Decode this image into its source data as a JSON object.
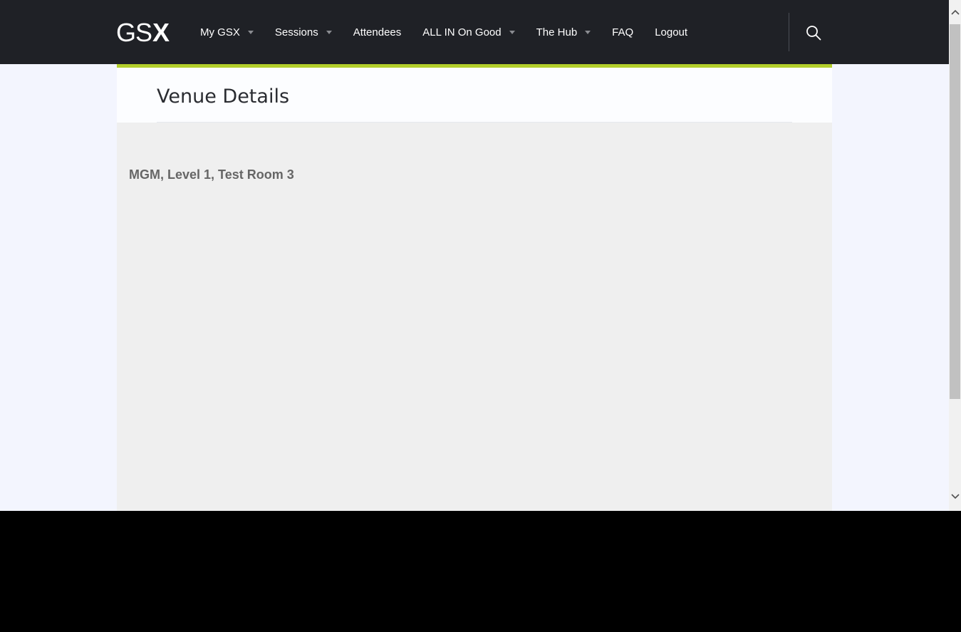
{
  "header": {
    "logo": {
      "part1": "GS",
      "part2": "X"
    },
    "nav": [
      {
        "label": "My GSX",
        "dropdown": true
      },
      {
        "label": "Sessions",
        "dropdown": true
      },
      {
        "label": "Attendees",
        "dropdown": false
      },
      {
        "label": "ALL IN On Good",
        "dropdown": true
      },
      {
        "label": "The Hub",
        "dropdown": true
      },
      {
        "label": "FAQ",
        "dropdown": false
      },
      {
        "label": "Logout",
        "dropdown": false
      }
    ],
    "search_icon": "search-icon"
  },
  "page": {
    "title": "Venue Details",
    "venue": "MGM, Level 1, Test Room 3"
  },
  "colors": {
    "topbar": "#1f2126",
    "accent": "#b3cf2b",
    "page_bg": "#f3f5fe",
    "content_bg": "#efefef",
    "title_text": "#2a2c31",
    "venue_text": "#666666"
  }
}
